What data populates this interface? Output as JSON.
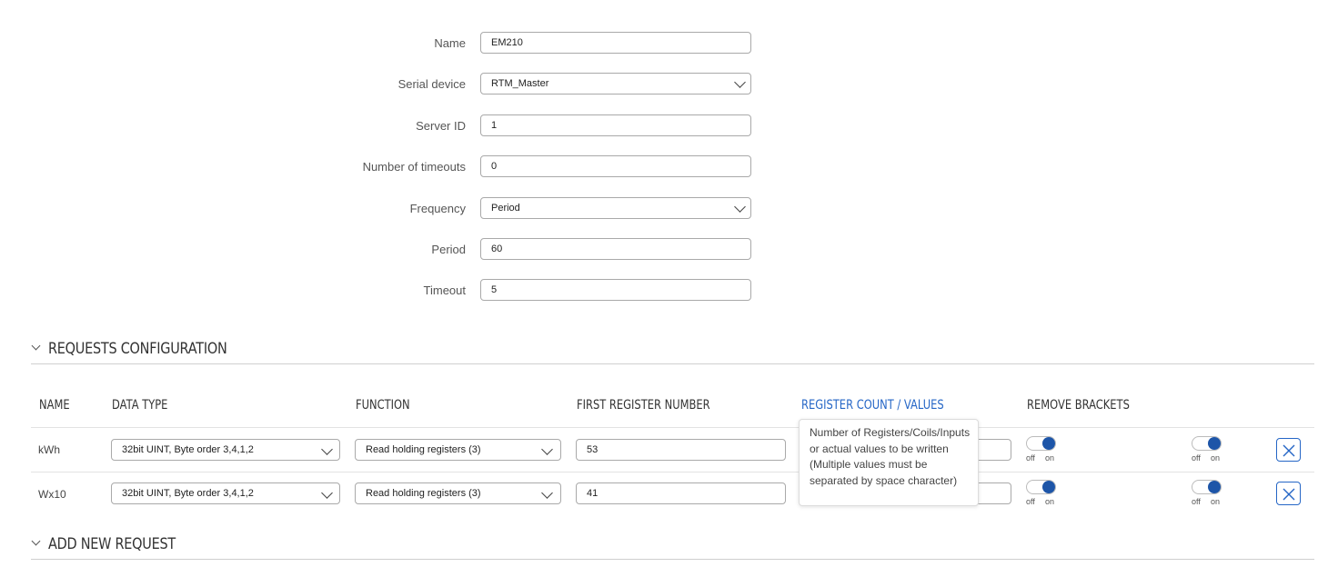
{
  "form": {
    "name": {
      "label": "Name",
      "value": "EM210"
    },
    "serial_device": {
      "label": "Serial device",
      "value": "RTM_Master"
    },
    "server_id": {
      "label": "Server ID",
      "value": "1"
    },
    "timeouts": {
      "label": "Number of timeouts",
      "value": "0"
    },
    "frequency": {
      "label": "Frequency",
      "value": "Period"
    },
    "period": {
      "label": "Period",
      "value": "60"
    },
    "timeout": {
      "label": "Timeout",
      "value": "5"
    }
  },
  "requests": {
    "title": "REQUESTS CONFIGURATION",
    "columns": [
      "NAME",
      "DATA TYPE",
      "FUNCTION",
      "FIRST REGISTER NUMBER",
      "REGISTER COUNT / VALUES",
      "REMOVE BRACKETS"
    ],
    "rows": [
      {
        "name": "kWh",
        "data_type": "32bit UINT, Byte order 3,4,1,2",
        "function": "Read holding registers (3)",
        "first_register": "53",
        "register_count": ""
      },
      {
        "name": "Wx10",
        "data_type": "32bit UINT, Byte order 3,4,1,2",
        "function": "Read holding registers (3)",
        "first_register": "41",
        "register_count": ""
      }
    ],
    "toggle_off": "off",
    "toggle_on": "on",
    "tooltip": "Number of Registers/Coils/Inputs or actual values to be written (Multiple values must be separated by space character)"
  },
  "add_new": {
    "title": "ADD NEW REQUEST"
  },
  "colors": {
    "accent": "#2566c6",
    "toggle_knob": "#1d55a8"
  }
}
